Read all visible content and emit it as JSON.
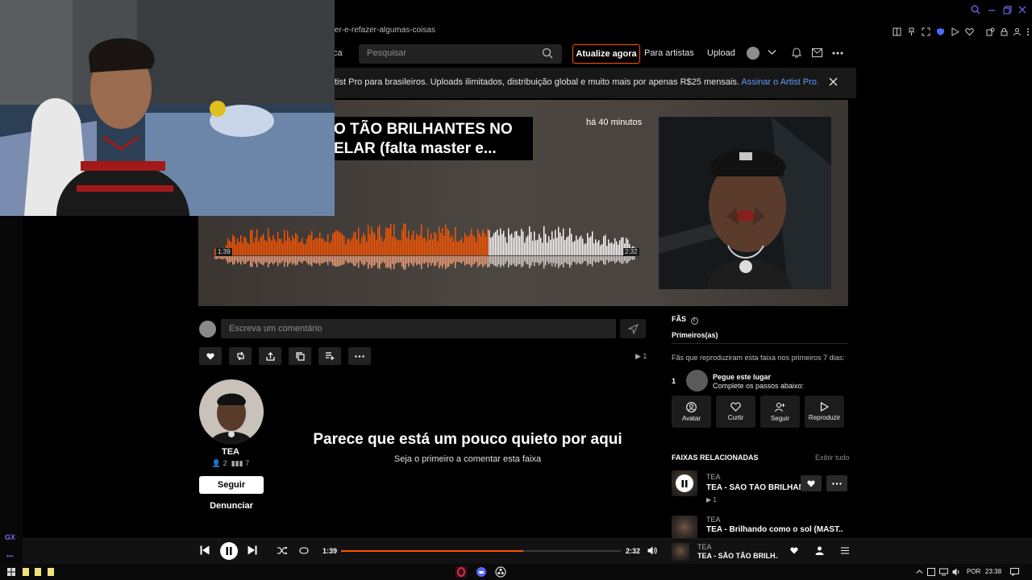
{
  "browser": {
    "url_fragment": "ter-e-refazer-algumas-coisas",
    "window_controls": [
      "search-icon",
      "minimize-icon",
      "restore-icon",
      "close-icon"
    ],
    "toolbar_icons": [
      "sidebar-icon",
      "pin-icon",
      "snapshot-icon",
      "shield-icon",
      "play-icon",
      "heart-icon",
      "extensions-icon",
      "lock-icon",
      "profile-icon",
      "menu-icon"
    ]
  },
  "nav": {
    "library_fragment": "ca",
    "search_placeholder": "Pesquisar",
    "upgrade_label": "Atualize agora",
    "for_artists_label": "Para artistas",
    "upload_label": "Upload",
    "accent": "#ff5500"
  },
  "banner": {
    "text": "tist Pro para brasileiros. Uploads ilimitados, distribuição global e muito mais por apenas R$25 mensais.",
    "link": "Assinar o Artist Pro."
  },
  "track": {
    "title": "O TÃO BRILHANTES NO\nELAR (falta master e...",
    "posted": "há 40 minutos",
    "elapsed": "1:39",
    "total": "2:32",
    "progress": 0.651,
    "play_count": "1"
  },
  "comment": {
    "placeholder": "Escreva um comentário"
  },
  "artist": {
    "name": "TEA",
    "followers": "2",
    "tracks": "7",
    "follow_label": "Seguir",
    "report_label": "Denunciar"
  },
  "empty_state": {
    "title": "Parece que está um pouco quieto por aqui",
    "subtitle": "Seja o primeiro a comentar esta faixa"
  },
  "fans": {
    "heading": "FÃS",
    "tab": "Primeiros(as)",
    "description": "Fãs que reproduziram esta faixa nos primeiros 7 dias:",
    "rank": "1",
    "slot_title": "Pegue este lugar",
    "slot_sub": "Complete os passos abaixo:",
    "steps": [
      "Avatar",
      "Curtir",
      "Seguir",
      "Reproduzir"
    ]
  },
  "related": {
    "heading": "FAIXAS RELACIONADAS",
    "view_all": "Exibir tudo",
    "items": [
      {
        "artist": "TEA",
        "title": "TEA - SÃO TÃO BRILHANTES",
        "plays": "1"
      },
      {
        "artist": "TEA",
        "title": "TEA - Brilhando como o sol (MAST..."
      }
    ]
  },
  "player": {
    "elapsed": "1:39",
    "total": "2:32",
    "progress": 0.651,
    "artist": "TEA",
    "title": "TEA - SÃO TÃO BRILH..."
  },
  "gx": {
    "logo": "GX"
  },
  "taskbar": {
    "lang": "POR",
    "time": "23:38"
  }
}
